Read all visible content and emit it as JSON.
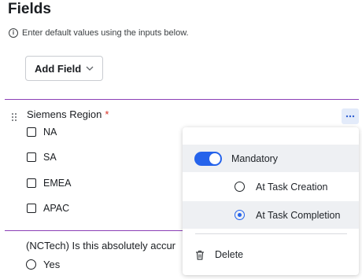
{
  "page": {
    "title": "Fields",
    "info_text": "Enter default values using the inputs below.",
    "info_icon": "info-icon"
  },
  "toolbar": {
    "add_field_label": "Add Field",
    "add_field_icon": "chevron-down-icon"
  },
  "field1": {
    "label": "Siemens Region",
    "required_mark": "*",
    "options": [
      "NA",
      "SA",
      "EMEA",
      "APAC"
    ]
  },
  "field2": {
    "label": "(NCTech) Is this absolutely accur",
    "options": [
      "Yes"
    ]
  },
  "menu": {
    "trigger_icon": "more-horizontal-icon",
    "mandatory_label": "Mandatory",
    "mandatory_on": true,
    "radio_options": [
      {
        "label": "At Task Creation",
        "selected": false
      },
      {
        "label": "At Task Completion",
        "selected": true
      }
    ],
    "delete_label": "Delete",
    "delete_icon": "trash-icon"
  },
  "colors": {
    "accent": "#2563eb",
    "divider": "#8b3fb6",
    "required": "#d93025",
    "menu_highlight": "#eef0f3",
    "more_button_bg": "#e3ebfa"
  }
}
